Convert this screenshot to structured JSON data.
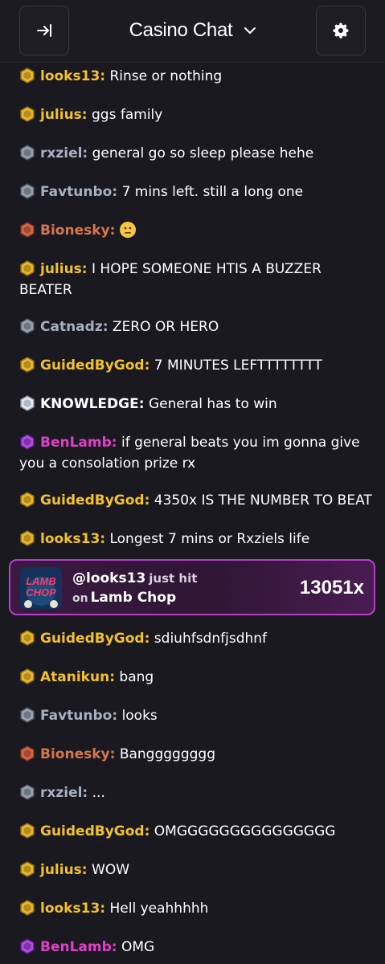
{
  "header": {
    "title": "Casino Chat",
    "collapse_icon": "collapse-panel-icon",
    "dropdown_icon": "chevron-down-icon",
    "settings_icon": "gear-icon"
  },
  "colors": {
    "gold": "#f2c12e",
    "silver": "#c8c8cc",
    "bronze": "#d4764e",
    "platinum": "#a8b0c0",
    "diamond": "#e040c8",
    "accent_border": "#b540c8"
  },
  "messages": [
    {
      "rank": "gold",
      "user": "looks13:",
      "text": "Rinse or nothing"
    },
    {
      "rank": "gold",
      "user": "julius:",
      "text": "ggs family"
    },
    {
      "rank": "platinum",
      "user": "rxziel:",
      "text": "general go so sleep please hehe"
    },
    {
      "rank": "platinum",
      "user": "Favtunbo:",
      "text": "7 mins left. still a long one"
    },
    {
      "rank": "bronze",
      "user": "Bionesky:",
      "text": "",
      "emoji": "neutral-face-icon"
    },
    {
      "rank": "gold",
      "user": "julius:",
      "text": "I HOPE SOMEONE HTIS A BUZZER BEATER"
    },
    {
      "rank": "platinum",
      "user": "Catnadz:",
      "text": "ZERO OR HERO"
    },
    {
      "rank": "gold",
      "user": "GuidedByGod:",
      "text": "7 MINUTES LEFTTTTTTTT"
    },
    {
      "rank": "white",
      "user": "KNOWLEDGE:",
      "text": "General has to win"
    },
    {
      "rank": "diamond",
      "user": "BenLamb:",
      "text": "if general beats you im gonna give you a consolation prize rx"
    },
    {
      "rank": "gold",
      "user": "GuidedByGod:",
      "text": "4350x IS THE NUMBER TO BEAT"
    },
    {
      "rank": "gold",
      "user": "looks13:",
      "text": "Longest 7 mins or Rxziels life"
    },
    {
      "rank": "gold",
      "user": "GuidedByGod:",
      "text": "sdiuhfsdnfjsdhnf"
    },
    {
      "rank": "gold",
      "user": "Atanikun:",
      "text": "bang"
    },
    {
      "rank": "platinum",
      "user": "Favtunbo:",
      "text": "looks"
    },
    {
      "rank": "bronze",
      "user": "Bionesky:",
      "text": "Bangggggggg"
    },
    {
      "rank": "platinum",
      "user": "rxziel:",
      "text": "..."
    },
    {
      "rank": "gold",
      "user": "GuidedByGod:",
      "text": "OMGGGGGGGGGGGGGGG"
    },
    {
      "rank": "gold",
      "user": "julius:",
      "text": "WOW"
    },
    {
      "rank": "gold",
      "user": "looks13:",
      "text": "Hell yeahhhhh"
    },
    {
      "rank": "diamond",
      "user": "BenLamb:",
      "text": "OMG"
    }
  ],
  "big_win": {
    "user": "@looks13",
    "action": "just hit",
    "on": "on",
    "game": "Lamb Chop",
    "multiplier": "13051x",
    "thumb_text_1": "LAMB",
    "thumb_text_2": "CHOP"
  }
}
